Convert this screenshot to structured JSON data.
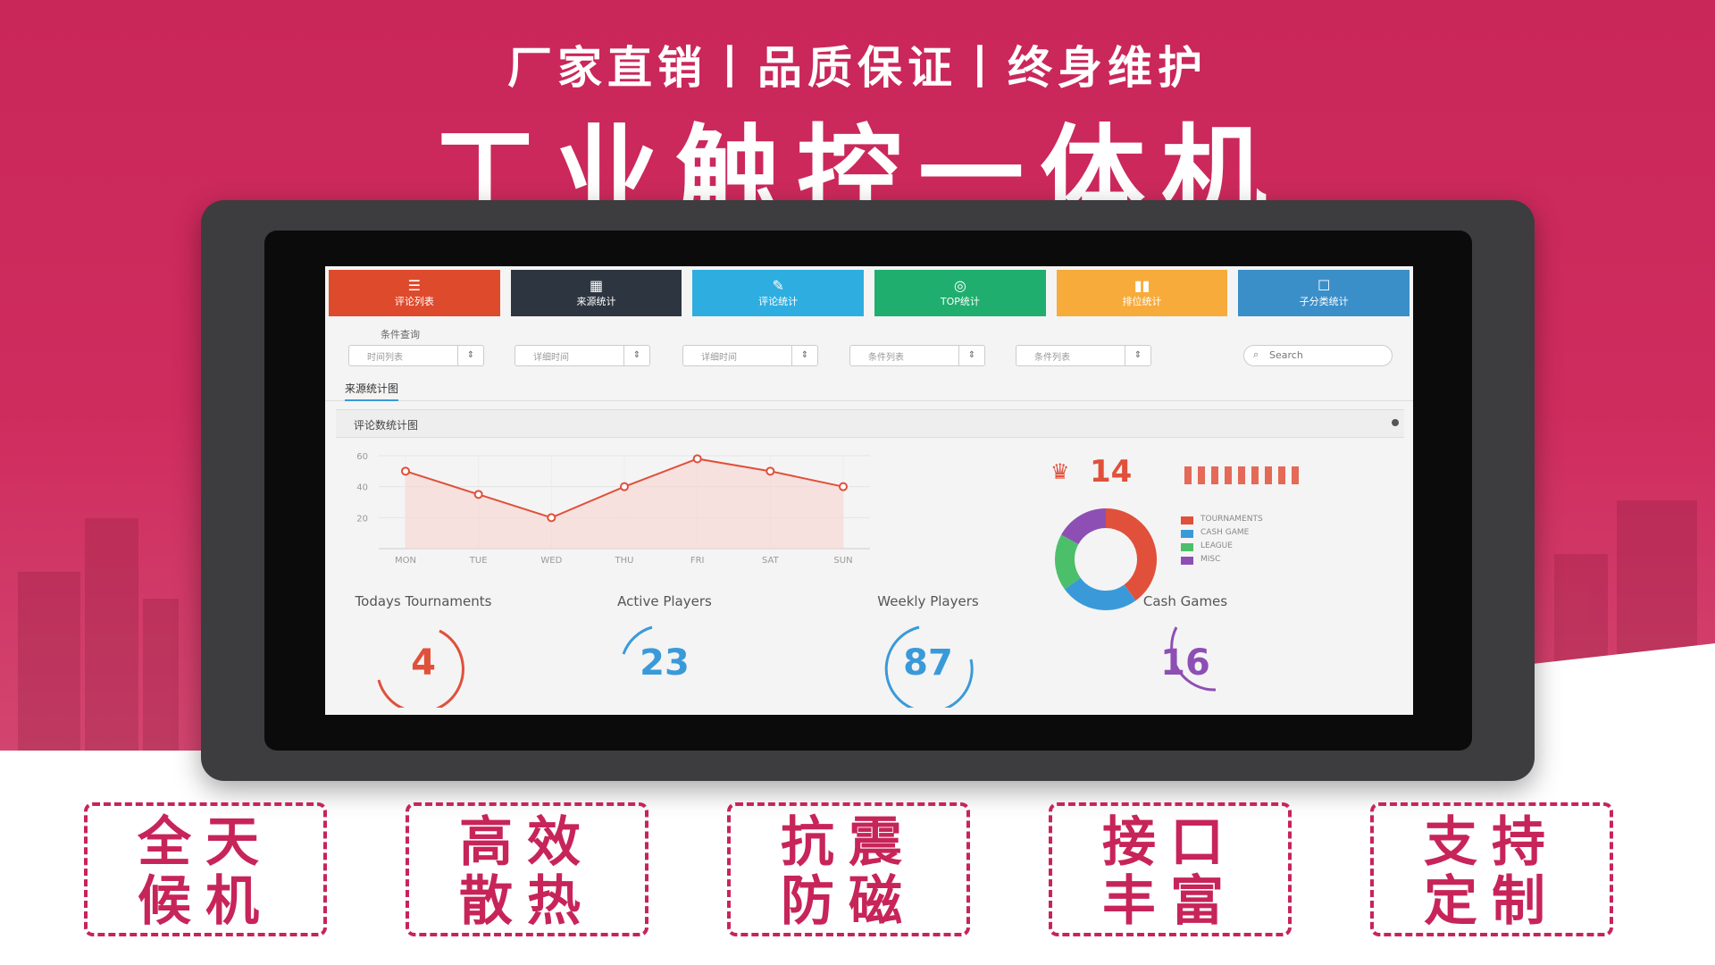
{
  "header": {
    "slogan": "厂家直销丨品质保证丨终身维护",
    "headline": "工业触控一体机"
  },
  "app": {
    "nav_tiles": [
      {
        "label": "评论列表",
        "icon": "list-icon",
        "color": "#de4a2c"
      },
      {
        "label": "来源统计",
        "icon": "grid-icon",
        "color": "#2d3640"
      },
      {
        "label": "评论统计",
        "icon": "edit-icon",
        "color": "#2eaee0"
      },
      {
        "label": "TOP统计",
        "icon": "medal-icon",
        "color": "#1fae6e"
      },
      {
        "label": "排位统计",
        "icon": "bar-chart-icon",
        "color": "#f7ab3b"
      },
      {
        "label": "子分类统计",
        "icon": "square-icon",
        "color": "#3a8fc9"
      }
    ],
    "filters": {
      "label": "条件查询",
      "selects": [
        "时间列表",
        "详细时间",
        "详细时间",
        "条件列表",
        "条件列表"
      ],
      "search_placeholder": "Search"
    },
    "tab": "来源统计图",
    "panel_title": "评论数统计图",
    "rank": {
      "value": "14"
    },
    "legend": [
      {
        "label": "TOURNAMENTS",
        "color": "#e0503b"
      },
      {
        "label": "CASH GAME",
        "color": "#3a9ad9"
      },
      {
        "label": "LEAGUE",
        "color": "#4cbf6b"
      },
      {
        "label": "MISC",
        "color": "#8e4fb5"
      }
    ],
    "stats": [
      {
        "label": "Todays Tournaments",
        "value": "4",
        "color": "#e0503b"
      },
      {
        "label": "Active Players",
        "value": "23",
        "color": "#3a9ad9"
      },
      {
        "label": "Weekly Players",
        "value": "87",
        "color": "#3a9ad9"
      },
      {
        "label": "Cash Games",
        "value": "16",
        "color": "#8e4fb5"
      }
    ]
  },
  "chart_data": [
    {
      "type": "area",
      "categories": [
        "MON",
        "TUE",
        "WED",
        "THU",
        "FRI",
        "SAT",
        "SUN"
      ],
      "series": [
        {
          "values": [
            50,
            35,
            20,
            40,
            58,
            50,
            40
          ]
        }
      ],
      "yticks": [
        "20",
        "40",
        "60"
      ],
      "ylim": [
        0,
        60
      ],
      "grid": true
    },
    {
      "type": "pie",
      "categories": [
        "TOURNAMENTS",
        "CASH GAME",
        "LEAGUE",
        "MISC"
      ],
      "values": [
        40,
        25,
        18,
        17
      ],
      "donut": true
    },
    {
      "type": "bar",
      "values": [
        5,
        5,
        5,
        5,
        5,
        5,
        5,
        5,
        5
      ],
      "color": "#e0503b"
    }
  ],
  "features": [
    {
      "line1": "全天",
      "line2": "候机"
    },
    {
      "line1": "高效",
      "line2": "散热"
    },
    {
      "line1": "抗震",
      "line2": "防磁"
    },
    {
      "line1": "接口",
      "line2": "丰富"
    },
    {
      "line1": "支持",
      "line2": "定制"
    }
  ]
}
